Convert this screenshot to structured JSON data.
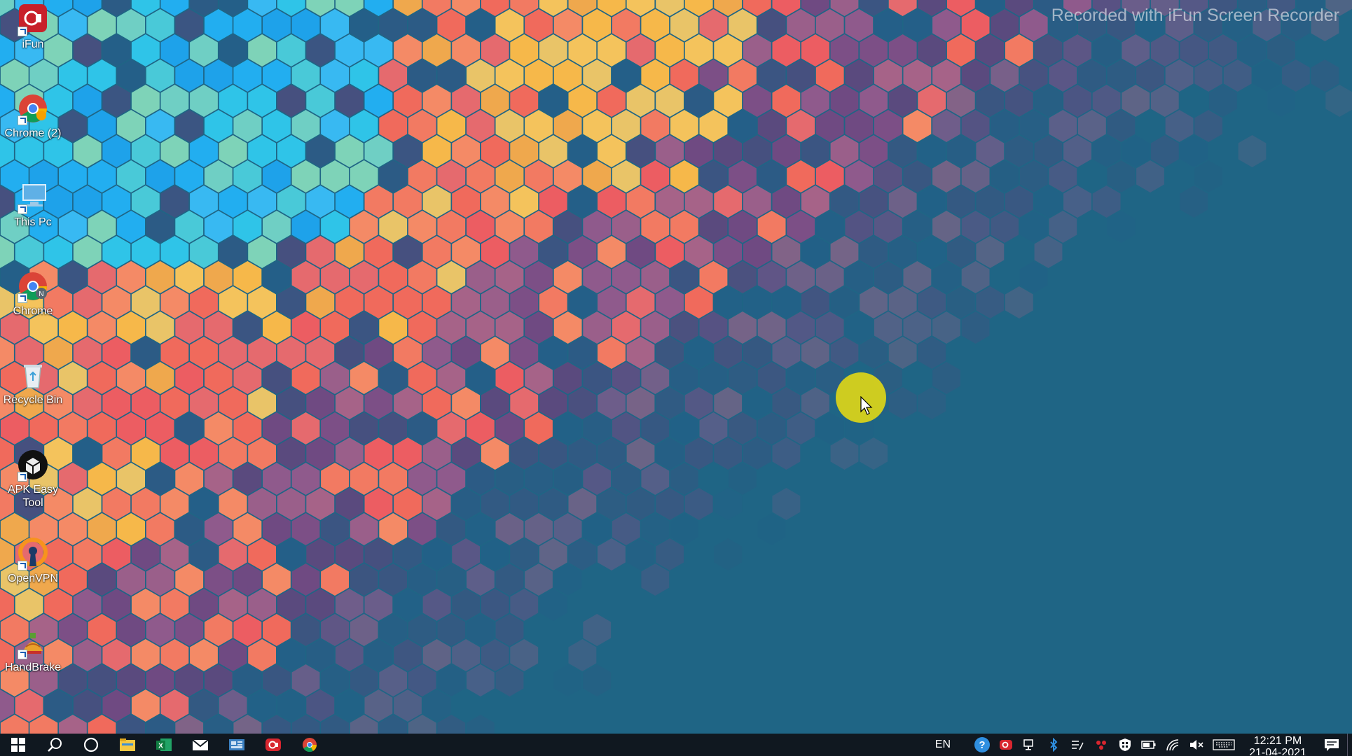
{
  "watermark": "Recorded with iFun Screen Recorder",
  "desktop_icons": [
    {
      "label": "iFun",
      "icon": "ifun-recorder-icon"
    },
    {
      "label": "Chrome (2)",
      "icon": "chrome-icon"
    },
    {
      "label": "This Pc",
      "icon": "computer-icon"
    },
    {
      "label": "Chrome",
      "icon": "chrome-icon"
    },
    {
      "label": "Recycle Bin",
      "icon": "recycle-bin-icon"
    },
    {
      "label": "APK Easy Tool",
      "icon": "apk-easy-tool-icon"
    },
    {
      "label": "OpenVPN",
      "icon": "openvpn-icon"
    },
    {
      "label": "HandBrake",
      "icon": "handbrake-icon"
    }
  ],
  "taskbar": {
    "pinned": [
      "start-icon",
      "search-icon",
      "cortana-icon",
      "file-explorer-icon",
      "excel-icon",
      "mail-icon",
      "app-icon",
      "ifun-recorder-icon",
      "chrome-icon"
    ],
    "language": "EN",
    "tray_icons": [
      "help-icon",
      "ifun-recorder-icon",
      "network-icon",
      "bluetooth-icon",
      "pen-icon",
      "app-icon",
      "security-icon",
      "battery-icon",
      "wifi-icon",
      "volume-muted-icon",
      "keyboard-icon"
    ],
    "time": "12:21 PM",
    "date": "21-04-2021"
  },
  "colors": {
    "desktop_background": "#1f6585",
    "taskbar": "#101820",
    "cursor_highlight": "#d8d21a"
  }
}
